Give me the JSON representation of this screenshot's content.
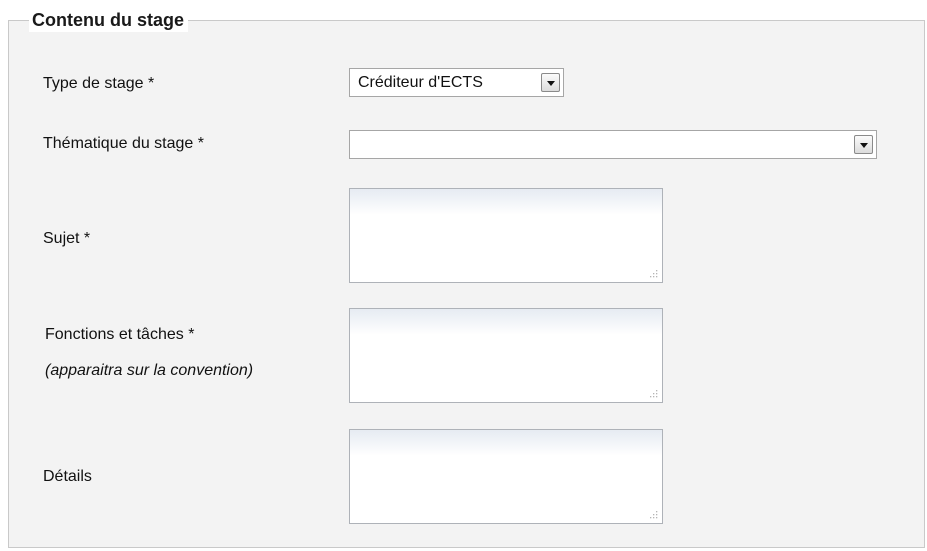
{
  "fieldset": {
    "legend": "Contenu du stage"
  },
  "fields": {
    "type_stage": {
      "label": "Type de stage *",
      "selected": "Créditeur d'ECTS"
    },
    "thematique": {
      "label": "Thématique du stage *",
      "selected": ""
    },
    "sujet": {
      "label": "Sujet *",
      "value": ""
    },
    "fonctions": {
      "label": "Fonctions et tâches *",
      "hint": "(apparaitra sur la convention)",
      "value": ""
    },
    "details": {
      "label": "Détails",
      "value": ""
    }
  },
  "icons": {
    "dropdown": "chevron-down-icon",
    "resize": "resize-grip-icon"
  },
  "colors": {
    "panel_background": "#f3f3f3",
    "border": "#c9c9c9",
    "input_border": "#a6a6a6",
    "textarea_top_tint": "#e6ebf2"
  }
}
